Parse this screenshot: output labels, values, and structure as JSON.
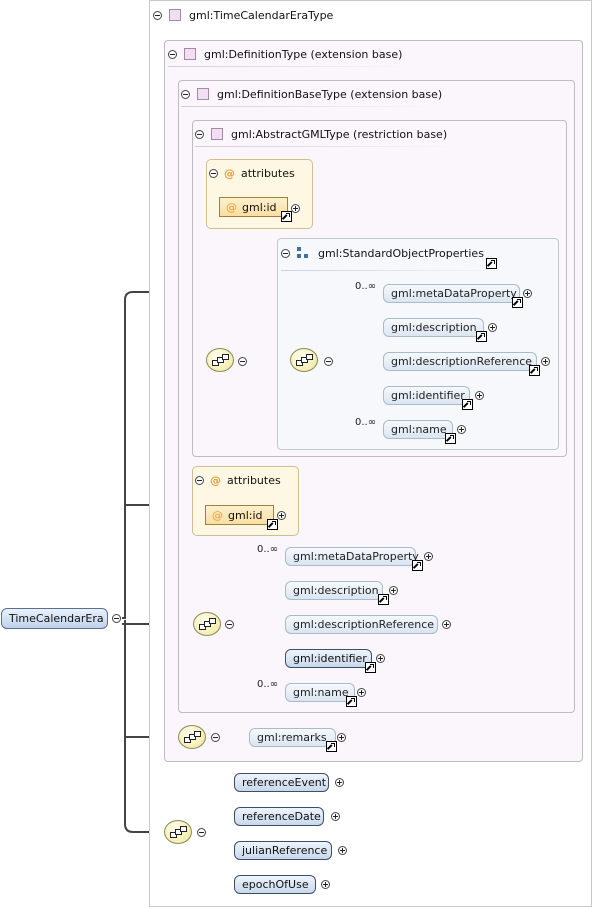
{
  "diagram": {
    "root_element": "TimeCalendarEra",
    "type_box": {
      "label": "gml:TimeCalendarEraType"
    },
    "definition_type": {
      "label": "gml:DefinitionType (extension base)"
    },
    "definition_base_type": {
      "label": "gml:DefinitionBaseType (extension base)"
    },
    "abstract_gml_type": {
      "label": "gml:AbstractGMLType (restriction base)"
    },
    "attributes_label": "attributes",
    "attribute_gml_id": "gml:id",
    "group": {
      "label": "gml:StandardObjectProperties"
    },
    "group_elements": [
      {
        "label": "gml:metaDataProperty",
        "occurs": "0..∞"
      },
      {
        "label": "gml:description",
        "occurs": ""
      },
      {
        "label": "gml:descriptionReference",
        "occurs": ""
      },
      {
        "label": "gml:identifier",
        "occurs": ""
      },
      {
        "label": "gml:name",
        "occurs": "0..∞"
      }
    ],
    "restriction_elements": [
      {
        "label": "gml:metaDataProperty",
        "occurs": "0..∞"
      },
      {
        "label": "gml:description",
        "occurs": ""
      },
      {
        "label": "gml:descriptionReference",
        "occurs": ""
      },
      {
        "label": "gml:identifier",
        "occurs": ""
      },
      {
        "label": "gml:name",
        "occurs": "0..∞"
      }
    ],
    "remarks": "gml:remarks",
    "own_elements": [
      "referenceEvent",
      "referenceDate",
      "julianReference",
      "epochOfUse"
    ]
  },
  "colors": {
    "element_fill": "#c8d8ec",
    "attribute_fill": "#f9dfa2",
    "box_fill": "#fbf6fb",
    "connector": "#444444"
  }
}
